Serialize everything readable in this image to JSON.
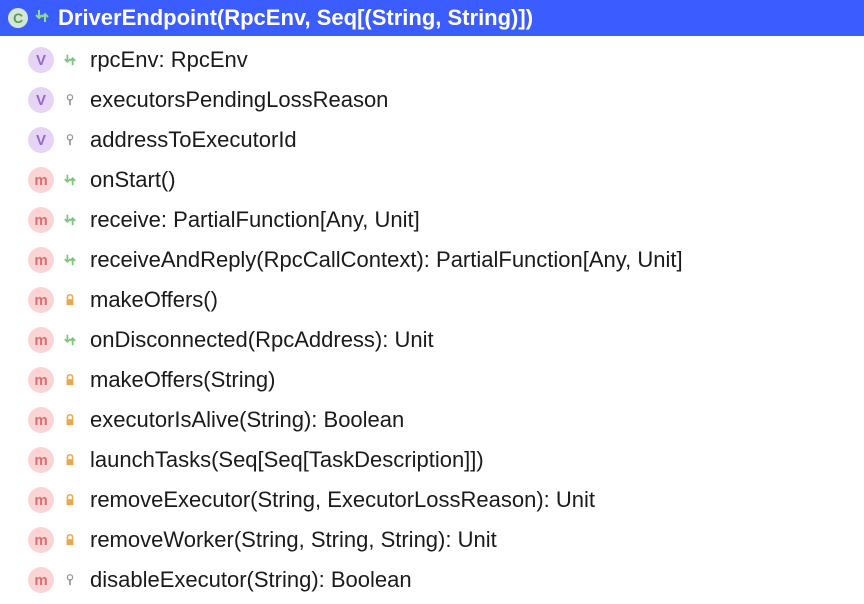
{
  "header": {
    "class_icon": "C",
    "visibility_icon": "⇵",
    "title": "DriverEndpoint(RpcEnv, Seq[(String, String)])"
  },
  "members": [
    {
      "kind": "v",
      "kind_label": "V",
      "visibility": "public",
      "vis_glyph": "⇵",
      "signature": "rpcEnv: RpcEnv"
    },
    {
      "kind": "v",
      "kind_label": "V",
      "visibility": "private",
      "vis_glyph": "🔑",
      "signature": "executorsPendingLossReason"
    },
    {
      "kind": "v",
      "kind_label": "V",
      "visibility": "private",
      "vis_glyph": "🔑",
      "signature": "addressToExecutorId"
    },
    {
      "kind": "m",
      "kind_label": "m",
      "visibility": "public",
      "vis_glyph": "⇵",
      "signature": "onStart()"
    },
    {
      "kind": "m",
      "kind_label": "m",
      "visibility": "public",
      "vis_glyph": "⇵",
      "signature": "receive: PartialFunction[Any, Unit]"
    },
    {
      "kind": "m",
      "kind_label": "m",
      "visibility": "public",
      "vis_glyph": "⇵",
      "signature": "receiveAndReply(RpcCallContext): PartialFunction[Any, Unit]"
    },
    {
      "kind": "m",
      "kind_label": "m",
      "visibility": "locked",
      "vis_glyph": "🔒",
      "signature": "makeOffers()"
    },
    {
      "kind": "m",
      "kind_label": "m",
      "visibility": "public",
      "vis_glyph": "⇵",
      "signature": "onDisconnected(RpcAddress): Unit"
    },
    {
      "kind": "m",
      "kind_label": "m",
      "visibility": "locked",
      "vis_glyph": "🔒",
      "signature": "makeOffers(String)"
    },
    {
      "kind": "m",
      "kind_label": "m",
      "visibility": "locked",
      "vis_glyph": "🔒",
      "signature": "executorIsAlive(String): Boolean"
    },
    {
      "kind": "m",
      "kind_label": "m",
      "visibility": "locked",
      "vis_glyph": "🔒",
      "signature": "launchTasks(Seq[Seq[TaskDescription]])"
    },
    {
      "kind": "m",
      "kind_label": "m",
      "visibility": "locked",
      "vis_glyph": "🔒",
      "signature": "removeExecutor(String, ExecutorLossReason): Unit"
    },
    {
      "kind": "m",
      "kind_label": "m",
      "visibility": "locked",
      "vis_glyph": "🔒",
      "signature": "removeWorker(String, String, String): Unit"
    },
    {
      "kind": "m",
      "kind_label": "m",
      "visibility": "private",
      "vis_glyph": "🔑",
      "signature": "disableExecutor(String): Boolean"
    }
  ]
}
